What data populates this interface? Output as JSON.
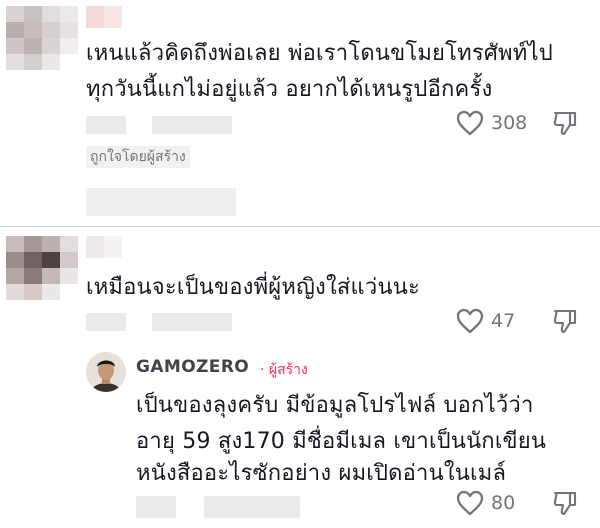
{
  "comments": [
    {
      "text_line1": "เหนแล้วคิดถึงพ่อเลย พ่อเราโดนขโมยโทรศัพท์ไป",
      "text_line2": "ทุกวันนี้แกไม่อยู่แล้ว อยากได้เหนรูปอีกครั้ง",
      "likes": "308",
      "badge": "ถูกใจโดยผู้สร้าง"
    },
    {
      "text_line1": "เหมือนจะเป็นของพี่ผู้หญิงใส่แว่นนะ",
      "likes": "47"
    }
  ],
  "reply": {
    "username": "GAMOZERO",
    "creator_label": "· ผู้สร้าง",
    "text_line1": "เป็นของลุงครับ มีข้อมูลโปรไฟล์ บอกไว้ว่า",
    "text_line2": "อายุ 59 สูง170 มีชื่อมีเมล เขาเป็นนักเขียน",
    "text_line3": "หนังสืออะไรซักอย่าง ผมเปิดอ่านในเมล์",
    "likes": "80"
  },
  "icons": {
    "like": "heart-outline-icon",
    "dislike": "thumbs-down-outline-icon"
  },
  "colors": {
    "creator_accent": "#fe2c55",
    "text": "#161823",
    "secondary": "#73747b"
  }
}
